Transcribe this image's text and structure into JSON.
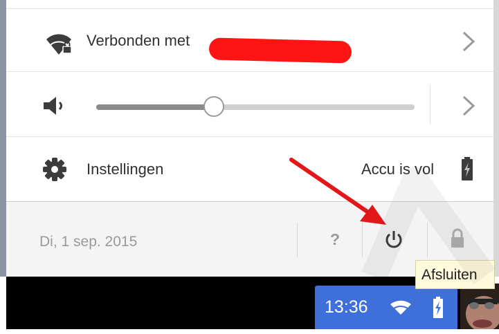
{
  "network": {
    "label": "Verbonden met"
  },
  "volume": {
    "level": 0.37
  },
  "settings": {
    "label": "Instellingen",
    "battery_label": "Accu is vol"
  },
  "footer": {
    "date": "Di, 1 sep. 2015",
    "help": "?"
  },
  "tooltip": {
    "text": "Afsluiten"
  },
  "taskbar": {
    "time": "13:36"
  },
  "colors": {
    "accent_tray": "#3f6fd8",
    "redaction": "#ff1414",
    "annotation_arrow": "#e3161a",
    "icon_gray": "#3c3c3c",
    "footer_gray": "#9a9a9a"
  },
  "icons": [
    "wifi-lock-icon",
    "chevron-right-icon",
    "speaker-icon",
    "gear-icon",
    "battery-icon",
    "power-icon",
    "lock-icon",
    "wifi-icon",
    "battery-charging-icon"
  ]
}
